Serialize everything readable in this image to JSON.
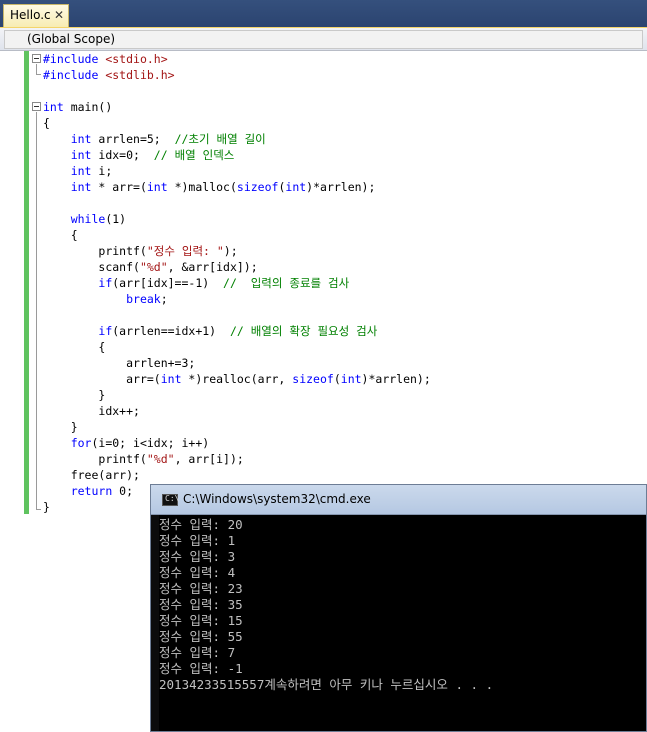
{
  "tab": {
    "label": "Hello.c",
    "close": "✕"
  },
  "scope": {
    "label": "(Global Scope)"
  },
  "code": {
    "l1_kw": "#include",
    "l1_str": "<stdio.h>",
    "l2_kw": "#include",
    "l2_str": "<stdlib.h>",
    "l4_kw": "int",
    "l4_txt": " main()",
    "l5": "{",
    "l6_kw": "int",
    "l6_txt": " arrlen=5;  ",
    "l6_cm": "//초기 배열 길이",
    "l7_kw": "int",
    "l7_txt": " idx=0;  ",
    "l7_cm": "// 배열 인덱스",
    "l8_kw": "int",
    "l8_txt": " i;",
    "l9_kw": "int",
    "l9_txt1": " * arr=(",
    "l9_kw2": "int",
    "l9_txt2": " *)malloc(",
    "l9_kw3": "sizeof",
    "l9_txt3": "(",
    "l9_kw4": "int",
    "l9_txt4": ")*arrlen);",
    "l11_kw": "while",
    "l11_txt": "(1)",
    "l12": "{",
    "l13_txt": "printf(",
    "l13_str": "\"정수 입력: \"",
    "l13_end": ");",
    "l14_txt": "scanf(",
    "l14_str": "\"%d\"",
    "l14_end": ", &arr[idx]);",
    "l15_kw": "if",
    "l15_txt": "(arr[idx]==-1)  ",
    "l15_cm": "//  입력의 종료를 검사",
    "l16_kw": "break",
    "l16_txt": ";",
    "l18_kw": "if",
    "l18_txt": "(arrlen==idx+1)  ",
    "l18_cm": "// 배열의 확장 필요성 검사",
    "l19": "{",
    "l20": "arrlen+=3;",
    "l21_txt1": "arr=(",
    "l21_kw": "int",
    "l21_txt2": " *)realloc(arr, ",
    "l21_kw2": "sizeof",
    "l21_txt3": "(",
    "l21_kw3": "int",
    "l21_txt4": ")*arrlen);",
    "l22": "}",
    "l23": "idx++;",
    "l24": "}",
    "l25_kw": "for",
    "l25_txt": "(i=0; i<idx; i++)",
    "l26_txt": "printf(",
    "l26_str": "\"%d\"",
    "l26_end": ", arr[i]);",
    "l27": "free(arr);",
    "l28_kw": "return",
    "l28_txt": " 0;",
    "l29": "}"
  },
  "console": {
    "title": "C:\\Windows\\system32\\cmd.exe",
    "icon_text": "C:\\",
    "lines": [
      "정수 입력: 20",
      "정수 입력: 1",
      "정수 입력: 3",
      "정수 입력: 4",
      "정수 입력: 23",
      "정수 입력: 35",
      "정수 입력: 15",
      "정수 입력: 55",
      "정수 입력: 7",
      "정수 입력: -1",
      "20134233515557계속하려면 아무 키나 누르십시오 . . ."
    ]
  },
  "colors": {
    "keyword": "#0000ff",
    "string": "#a31515",
    "comment": "#008000",
    "change_bar": "#5fc35f"
  }
}
